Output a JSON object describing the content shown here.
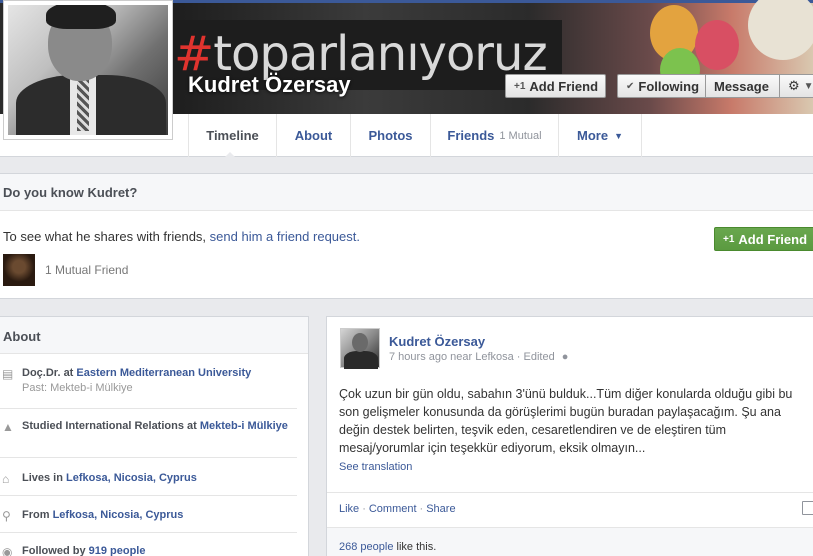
{
  "profile": {
    "name": "Kudret Özersay",
    "first_name_question": "Do you know Kudret?",
    "cover_hashtag": "#toparlanıyoruz"
  },
  "header_buttons": {
    "add_friend": "Add Friend",
    "following": "Following",
    "message": "Message",
    "gear": "⚙"
  },
  "tabs": [
    {
      "label": "Timeline",
      "active": true
    },
    {
      "label": "About"
    },
    {
      "label": "Photos"
    },
    {
      "label": "Friends",
      "sub": "1 Mutual"
    },
    {
      "label": "More"
    }
  ],
  "know_box": {
    "share_text_prefix": "To see what he shares with friends, ",
    "share_link": "send him a friend request.",
    "mutual": "1 Mutual Friend",
    "add_friend": "Add Friend"
  },
  "about": {
    "title": "About",
    "items": [
      {
        "pre": "Doç.Dr. at ",
        "link": "Eastern Mediterranean University",
        "sub": "Past: Mekteb-i Mülkiye"
      },
      {
        "pre": "Studied International Relations at ",
        "link": "Mekteb-i Mülkiye"
      },
      {
        "pre": "Lives in ",
        "link": "Lefkosa, Nicosia, Cyprus"
      },
      {
        "pre": "From ",
        "link": "Lefkosa, Nicosia, Cyprus"
      },
      {
        "pre": "Followed by ",
        "link": "919 people"
      }
    ]
  },
  "post": {
    "author": "Kudret Özersay",
    "meta": "7 hours ago near Lefkosa · Edited",
    "text": "Çok uzun bir gün oldu, sabahın 3'ünü bulduk...Tüm diğer konularda olduğu gibi bu son gelişmeler konusunda da görüşlerimi bugün buradan paylaşacağım. Şu ana değin destek belirten, teşvik eden, cesaretlendiren ve de eleştiren tüm mesaj/yorumlar için teşekkür ediyorum, eksik olmayın...",
    "see_translation": "See translation",
    "actions": [
      "Like",
      "Comment",
      "Share"
    ],
    "likes_count": "268 people",
    "likes_suffix": " like this."
  }
}
